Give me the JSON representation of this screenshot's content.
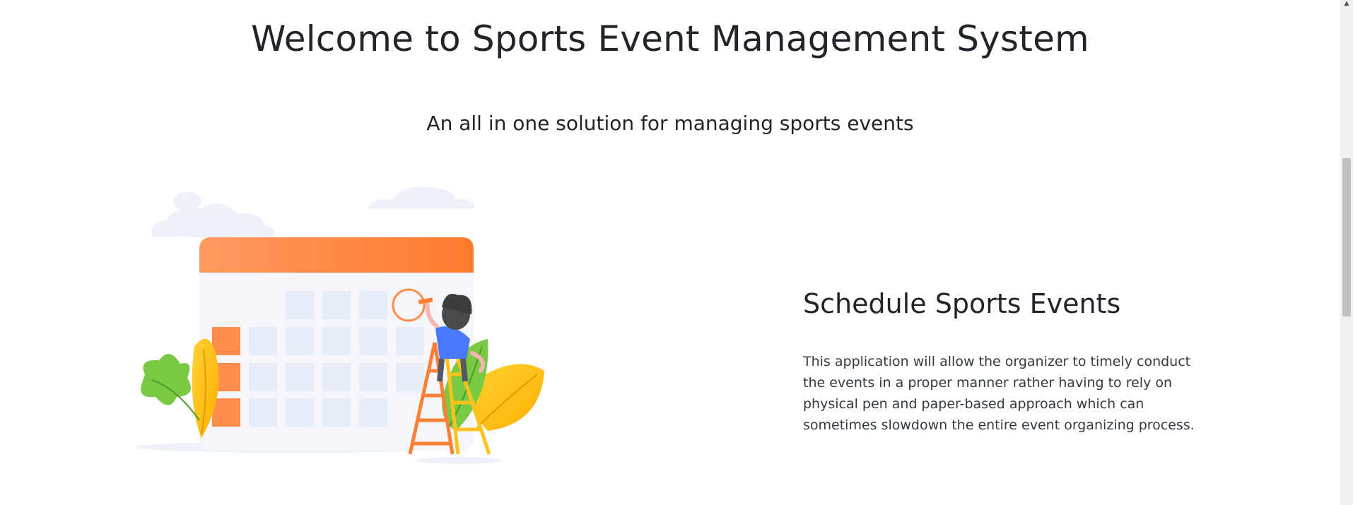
{
  "hero": {
    "title": "Welcome to Sports Event Management System",
    "subtitle": "An all in one solution for managing sports events"
  },
  "feature": {
    "title": "Schedule Sports Events",
    "description": "This application will allow the organizer to timely conduct the events in a proper manner rather having to rely on physical pen and paper-based approach which can sometimes slowdown the entire event organizing process.",
    "illustration_icon": "calendar-scheduling-illustration"
  },
  "scrollbar": {
    "up_arrow_icon": "chevron-up-icon"
  },
  "colors": {
    "text": "#212529",
    "accent_orange": "#ff7f36",
    "calendar_cell": "#e8eef7",
    "leaf_green": "#7ac943",
    "leaf_yellow": "#ffc21a",
    "person_shirt": "#4a78ff"
  }
}
